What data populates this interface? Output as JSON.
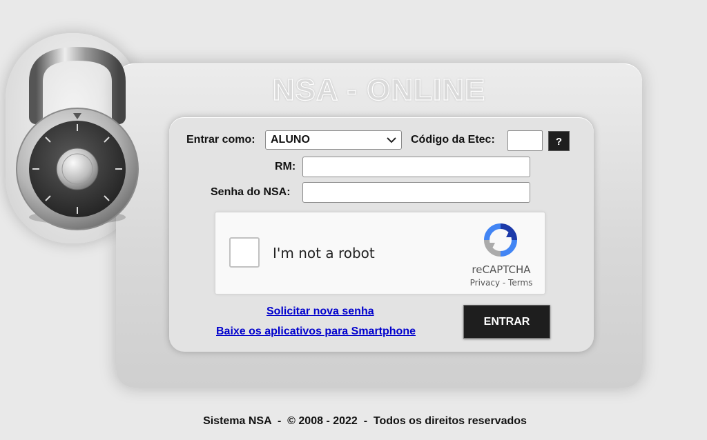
{
  "app": {
    "title": "NSA - ONLINE"
  },
  "login": {
    "role_label": "Entrar como:",
    "role_value": "ALUNO",
    "etec_label": "Código da Etec:",
    "etec_value": "",
    "help_label": "?",
    "rm_label": "RM:",
    "rm_value": "",
    "password_label": "Senha do NSA:",
    "password_value": ""
  },
  "recaptcha": {
    "label": "I'm not a robot",
    "brand": "reCAPTCHA",
    "privacy": "Privacy",
    "separator": " - ",
    "terms": "Terms",
    "icon": "recaptcha-logo-icon"
  },
  "links": {
    "new_password": "Solicitar nova senha",
    "apps": "Baixe os aplicativos para Smartphone"
  },
  "actions": {
    "submit_label": "ENTRAR"
  },
  "footer": {
    "text": "Sistema NSA  -  © 2008 - 2022  -  Todos os direitos reservados"
  },
  "icons": {
    "lock": "padlock-icon",
    "dropdown": "chevron-down-icon"
  },
  "colors": {
    "link": "#0000cc",
    "button": "#1e1e1e",
    "background": "#e9e9e9"
  }
}
